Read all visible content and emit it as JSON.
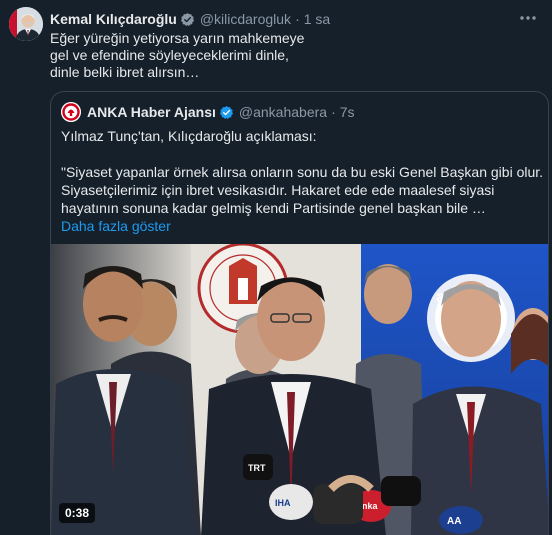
{
  "tweet": {
    "author_name": "Kemal Kılıçdaroğlu",
    "handle": "@kilicdarogluk",
    "separator": "·",
    "time": "1 sa",
    "more_icon": "more-icon",
    "lines": [
      "Eğer yüreğin yetiyorsa yarın mahkemeye",
      "gel ve efendine söyleyeceklerimi dinle,",
      "dinle belki ibret alırsın…"
    ]
  },
  "quote": {
    "author_name": "ANKA Haber Ajansı",
    "handle": "@ankahabera",
    "separator": "·",
    "time": "7s",
    "lines": [
      "Yılmaz Tunç'tan, Kılıçdaroğlu açıklaması:",
      "",
      "\"Siyaset yapanlar örnek alırsa onların sonu da bu eski Genel Başkan gibi olur.",
      "Siyasetçilerimiz için ibret vesikasıdır. Hakaret ede ede maalesef siyasi",
      "hayatının sonuna kadar gelmiş kendi Partisinde genel başkan bile …"
    ],
    "show_more": "Daha fazla göster",
    "media": {
      "logo_text": "anka",
      "duration": "0:38",
      "mic_labels": [
        "TRT",
        "IHA",
        "anka",
        "AA"
      ]
    }
  },
  "colors": {
    "background": "#15202b",
    "text": "#e7e9ea",
    "secondary": "#8b98a5",
    "link": "#1d9bf0",
    "border": "#38444d",
    "verified": "#1d9bf0"
  }
}
